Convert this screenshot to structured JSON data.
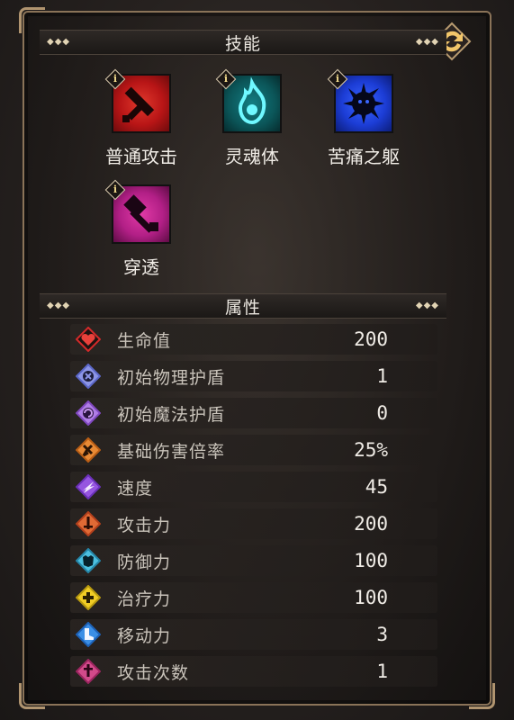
{
  "skills_section": {
    "title": "技能",
    "skills": [
      {
        "name": "普通攻击",
        "icon": "sword-icon",
        "color": "#b81516"
      },
      {
        "name": "灵魂体",
        "icon": "soul-flame-icon",
        "color": "#0b6a6d"
      },
      {
        "name": "苦痛之躯",
        "icon": "spiked-body-icon",
        "color": "#1c3dd6"
      },
      {
        "name": "穿透",
        "icon": "pierce-hammer-icon",
        "color": "#b21f86"
      }
    ],
    "info_marker": "i"
  },
  "attributes_section": {
    "title": "属性",
    "rows": [
      {
        "name": "生命值",
        "value": "200",
        "icon": "heart-icon",
        "color": "#d32a2a"
      },
      {
        "name": "初始物理护盾",
        "value": "1",
        "icon": "physical-shield-icon",
        "color": "#6f7de0"
      },
      {
        "name": "初始魔法护盾",
        "value": "0",
        "icon": "magic-shield-icon",
        "color": "#9a5ad0"
      },
      {
        "name": "基础伤害倍率",
        "value": "25%",
        "icon": "damage-multiplier-icon",
        "color": "#e07a25"
      },
      {
        "name": "速度",
        "value": "45",
        "icon": "speed-wing-icon",
        "color": "#8a45d8"
      },
      {
        "name": "攻击力",
        "value": "200",
        "icon": "attack-sword-icon",
        "color": "#d9542a"
      },
      {
        "name": "防御力",
        "value": "100",
        "icon": "defense-armor-icon",
        "color": "#39a9cf"
      },
      {
        "name": "治疗力",
        "value": "100",
        "icon": "healing-cross-icon",
        "color": "#e7c21f"
      },
      {
        "name": "移动力",
        "value": "3",
        "icon": "move-boot-icon",
        "color": "#2d7fdb"
      },
      {
        "name": "攻击次数",
        "value": "1",
        "icon": "attack-count-icon",
        "color": "#c23a7a"
      }
    ]
  },
  "controls": {
    "swap_icon": "swap-arrows-icon"
  },
  "colors": {
    "frame": "#8a7358",
    "header_dots": "#e2d4b4",
    "text": "#f0ece6"
  }
}
